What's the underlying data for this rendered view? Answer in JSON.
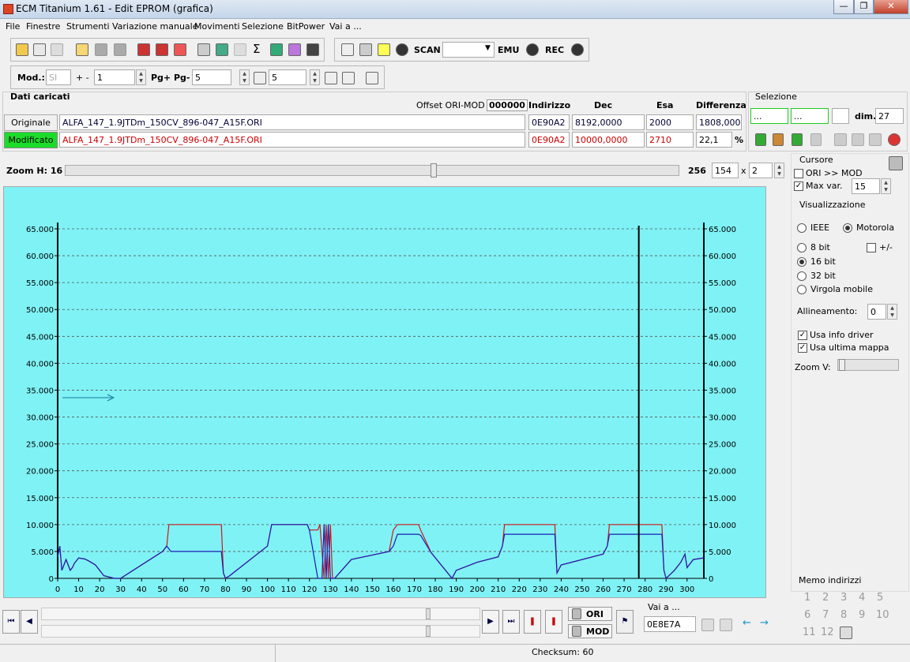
{
  "window": {
    "title": "ECM Titanium 1.61 - Edit EPROM (grafica)"
  },
  "menu": [
    "File",
    "Finestre",
    "Strumenti",
    "Variazione manuale",
    "Movimenti",
    "Selezione",
    "BitPower",
    "Vai a ..."
  ],
  "toolbar": {
    "scan": "SCAN",
    "scan_value": "",
    "emu": "EMU",
    "rec": "REC"
  },
  "mod": {
    "label": "Mod.:",
    "value": "SI",
    "plus_minus": "+ -",
    "step": "1",
    "pg_label": "Pg+ Pg-",
    "pg_value": "5",
    "p_value": "5"
  },
  "loaded": {
    "title": "Dati caricati",
    "offset_label": "Offset ORI-MOD",
    "offset_value": "000000",
    "col_addr": "Indirizzo",
    "col_dec": "Dec",
    "col_hex": "Esa",
    "col_diff": "Differenza",
    "orig": {
      "label": "Originale",
      "file": "ALFA_147_1.9JTDm_150CV_896-047_A15F.ORI",
      "addr": "0E90A2",
      "dec": "8192,0000",
      "hex": "2000",
      "diff": "1808,0000"
    },
    "mod": {
      "label": "Modificato",
      "file": "ALFA_147_1.9JTDm_150CV_896-047_A15F.ORI",
      "addr": "0E90A2",
      "dec": "10000,0000",
      "hex": "2710",
      "diff": "22,1",
      "pct": "%"
    }
  },
  "selection": {
    "title": "Selezione",
    "from": "...",
    "to": "...",
    "dim_label": "dim.",
    "dim": "27"
  },
  "zoom": {
    "label": "Zoom H: 16",
    "max": "256",
    "value": "154",
    "x": "x",
    "factor": "2",
    "level": 0.6
  },
  "cursor": {
    "title": "Cursore",
    "ori_mod": "ORI >> MOD",
    "maxvar": "Max var.",
    "maxvar_value": "15"
  },
  "view": {
    "title": "Visualizzazione",
    "ieee": "IEEE",
    "motorola": "Motorola",
    "b8": "8 bit",
    "sign": "+/-",
    "b16": "16 bit",
    "b32": "32 bit",
    "float": "Virgola mobile",
    "align_label": "Allineamento:",
    "align": "0",
    "driver": "Usa info driver",
    "lastmap": "Usa ultima mappa",
    "zoomv": "Zoom V:"
  },
  "memo": {
    "title": "Memo indirizzi",
    "items": [
      "1",
      "2",
      "3",
      "4",
      "5",
      "6",
      "7",
      "8",
      "9",
      "10",
      "11",
      "12"
    ]
  },
  "bottom": {
    "ori": "ORI",
    "mod": "MOD",
    "goto_label": "Vai a ...",
    "goto_value": "0E8E7A"
  },
  "status": {
    "checksum": "Checksum: 60"
  },
  "chart_data": {
    "type": "line",
    "xlim": [
      0,
      308
    ],
    "ylim": [
      0,
      65000
    ],
    "xticks": [
      0,
      10,
      20,
      30,
      40,
      50,
      60,
      70,
      80,
      90,
      100,
      110,
      120,
      130,
      140,
      150,
      160,
      170,
      180,
      190,
      200,
      210,
      220,
      230,
      240,
      250,
      260,
      270,
      280,
      290,
      300
    ],
    "yticks": [
      "0",
      "5.000",
      "10.000",
      "15.000",
      "20.000",
      "25.000",
      "30.000",
      "35.000",
      "40.000",
      "45.000",
      "50.000",
      "55.000",
      "60.000",
      "65.000"
    ],
    "cursor_x": 277,
    "colors": {
      "ori": "#1c1cb4",
      "mod": "#d01818",
      "cursor": "#000000"
    },
    "series": [
      {
        "id": "mod",
        "points": [
          [
            0,
            4000
          ],
          [
            1,
            6000
          ],
          [
            2,
            1500
          ],
          [
            4,
            3500
          ],
          [
            6,
            1500
          ],
          [
            7,
            2000
          ],
          [
            8,
            2800
          ],
          [
            10,
            3800
          ],
          [
            13,
            3600
          ],
          [
            15,
            3200
          ],
          [
            18,
            2500
          ],
          [
            22,
            500
          ],
          [
            27,
            0
          ],
          [
            30,
            0
          ],
          [
            50,
            5000
          ],
          [
            52,
            6000
          ],
          [
            53,
            10000
          ],
          [
            78,
            10000
          ],
          [
            79,
            1000
          ],
          [
            80,
            0
          ],
          [
            82,
            500
          ],
          [
            100,
            6000
          ],
          [
            102,
            10000
          ],
          [
            119,
            10000
          ],
          [
            120,
            9000
          ],
          [
            124,
            9000
          ],
          [
            125,
            10000
          ],
          [
            127,
            0
          ],
          [
            128,
            10000
          ],
          [
            129,
            0
          ],
          [
            130,
            10000
          ],
          [
            131,
            0
          ],
          [
            132,
            0
          ],
          [
            140,
            3500
          ],
          [
            158,
            5000
          ],
          [
            160,
            9000
          ],
          [
            162,
            10000
          ],
          [
            172,
            10000
          ],
          [
            173,
            9000
          ],
          [
            178,
            4800
          ],
          [
            188,
            0
          ],
          [
            190,
            1500
          ],
          [
            200,
            3000
          ],
          [
            210,
            4000
          ],
          [
            212,
            6000
          ],
          [
            213,
            10000
          ],
          [
            237,
            10000
          ],
          [
            238,
            1000
          ],
          [
            240,
            2500
          ],
          [
            260,
            4500
          ],
          [
            262,
            6000
          ],
          [
            263,
            10000
          ],
          [
            288,
            10000
          ],
          [
            289,
            1500
          ],
          [
            290,
            0
          ],
          [
            294,
            1500
          ],
          [
            297,
            3000
          ],
          [
            299,
            4500
          ],
          [
            300,
            2000
          ],
          [
            301,
            2500
          ],
          [
            303,
            3500
          ],
          [
            308,
            3800
          ]
        ]
      },
      {
        "id": "ori",
        "points": [
          [
            0,
            4000
          ],
          [
            1,
            6000
          ],
          [
            2,
            1500
          ],
          [
            4,
            3500
          ],
          [
            6,
            1500
          ],
          [
            7,
            2000
          ],
          [
            8,
            2800
          ],
          [
            10,
            3800
          ],
          [
            13,
            3600
          ],
          [
            15,
            3200
          ],
          [
            18,
            2500
          ],
          [
            22,
            500
          ],
          [
            27,
            0
          ],
          [
            30,
            0
          ],
          [
            50,
            5000
          ],
          [
            52,
            6000
          ],
          [
            54,
            5000
          ],
          [
            78,
            5000
          ],
          [
            79,
            1000
          ],
          [
            80,
            0
          ],
          [
            82,
            500
          ],
          [
            100,
            6000
          ],
          [
            102,
            10000
          ],
          [
            119,
            10000
          ],
          [
            120,
            9000
          ],
          [
            124,
            0
          ],
          [
            126,
            0
          ],
          [
            127,
            10000
          ],
          [
            128,
            0
          ],
          [
            129,
            10000
          ],
          [
            130,
            0
          ],
          [
            131,
            0
          ],
          [
            132,
            0
          ],
          [
            140,
            3500
          ],
          [
            158,
            5000
          ],
          [
            160,
            6000
          ],
          [
            162,
            8200
          ],
          [
            172,
            8200
          ],
          [
            173,
            8000
          ],
          [
            178,
            4800
          ],
          [
            188,
            0
          ],
          [
            190,
            1500
          ],
          [
            200,
            3000
          ],
          [
            210,
            4000
          ],
          [
            212,
            6000
          ],
          [
            213,
            8200
          ],
          [
            237,
            8200
          ],
          [
            238,
            1000
          ],
          [
            240,
            2500
          ],
          [
            260,
            4500
          ],
          [
            262,
            6000
          ],
          [
            263,
            8200
          ],
          [
            288,
            8200
          ],
          [
            289,
            1500
          ],
          [
            290,
            0
          ],
          [
            294,
            1500
          ],
          [
            297,
            3000
          ],
          [
            299,
            4500
          ],
          [
            300,
            2000
          ],
          [
            301,
            2500
          ],
          [
            303,
            3500
          ],
          [
            308,
            3800
          ]
        ]
      }
    ]
  }
}
